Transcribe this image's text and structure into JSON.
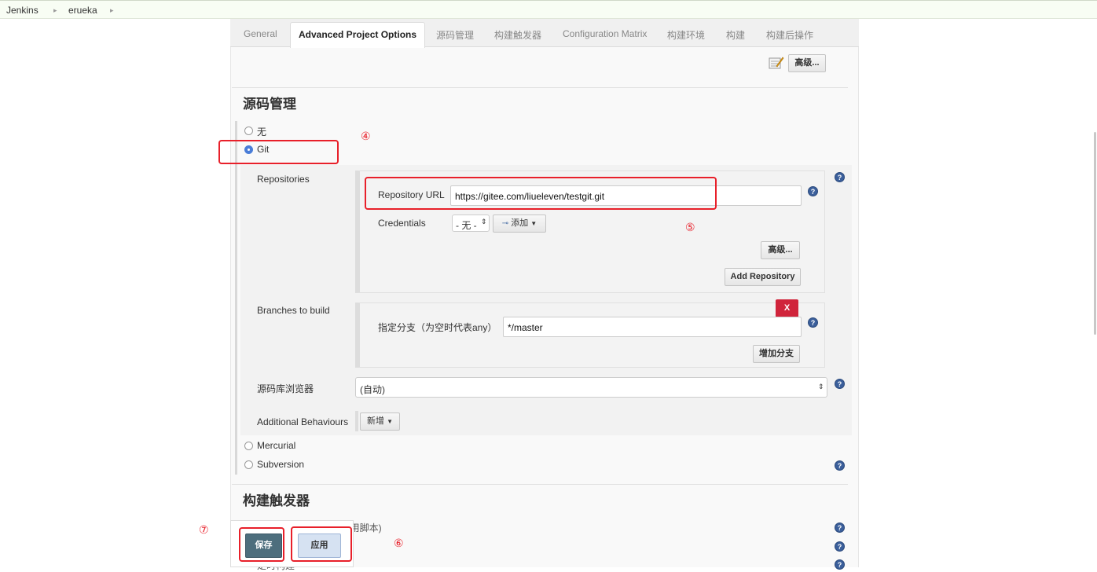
{
  "breadcrumb": [
    "Jenkins",
    "erueka"
  ],
  "tabs": [
    "General",
    "Advanced Project Options",
    "源码管理",
    "构建触发器",
    "Configuration Matrix",
    "构建环境",
    "构建",
    "构建后操作"
  ],
  "top_advanced_button": "高级...",
  "scm": {
    "title": "源码管理",
    "options": {
      "none": "无",
      "git": "Git",
      "mercurial": "Mercurial",
      "subversion": "Subversion"
    },
    "repositories_label": "Repositories",
    "repository_url_label": "Repository URL",
    "repository_url_value": "https://gitee.com/liueleven/testgit.git",
    "credentials_label": "Credentials",
    "credentials_selected": "- 无 -",
    "add_button": "添加",
    "advanced_button": "高级...",
    "add_repository_button": "Add Repository",
    "branches_label": "Branches to build",
    "branch_specifier_label": "指定分支（为空时代表any）",
    "branch_specifier_value": "*/master",
    "delete_branch_button": "X",
    "add_branch_button": "增加分支",
    "browser_label": "源码库浏览器",
    "browser_selected": "(自动)",
    "additional_behaviours_label": "Additional Behaviours",
    "add_behaviour_button": "新增"
  },
  "triggers": {
    "title": "构建触发器",
    "option1_partial": "触发远程构建 (例如,使用脚本)",
    "option3_partial": "定时构建"
  },
  "actions": {
    "save": "保存",
    "apply": "应用"
  },
  "annotations": {
    "a4": "④",
    "a5": "⑤",
    "a6": "⑥",
    "a7": "⑦"
  },
  "help_icon_glyph": "?",
  "colors": {
    "highlight_red": "#e8202a",
    "save_button": "#4d6e7d",
    "apply_button": "#d6e2f2",
    "delete_red": "#d0243b"
  }
}
